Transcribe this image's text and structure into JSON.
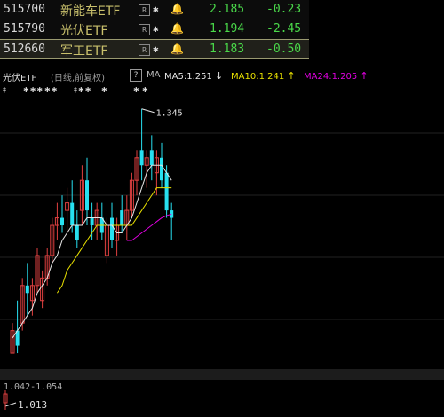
{
  "watchlist": [
    {
      "code": "515700",
      "name": "新能车ETF",
      "r_badge": "R",
      "star": "✱",
      "price": "2.185",
      "change": "-0.23"
    },
    {
      "code": "515790",
      "name": "光伏ETF",
      "r_badge": "R",
      "star": "✱",
      "price": "1.194",
      "change": "-2.45"
    },
    {
      "code": "512660",
      "name": "军工ETF",
      "r_badge": "R",
      "star": "✱",
      "price": "1.183",
      "change": "-0.50"
    }
  ],
  "chart_header": {
    "name": "光伏ETF",
    "mode": "(日线,前复权)",
    "help": "?",
    "ma_label": "MA",
    "ma5": "MA5:1.251",
    "ma5_arrow": "↓",
    "ma10": "MA10:1.241",
    "ma10_arrow": "↑",
    "ma24": "MA24:1.205",
    "ma24_arrow": "↑"
  },
  "markers": [
    {
      "text": "‡"
    },
    {
      "text": "✱✱✱"
    },
    {
      "text": "✱✱"
    },
    {
      "text": "‡✱✱"
    },
    {
      "text": "✱"
    },
    {
      "text": "✱"
    },
    {
      "text": "✱"
    }
  ],
  "colors": {
    "up": "#e04040",
    "down": "#27e0f0",
    "ma5": "#e6e6e6",
    "ma10": "#e8e000",
    "ma24": "#e000e0",
    "price_change": "#4ad94a",
    "name": "#c9c06c"
  },
  "range_text": "1.042-1.054",
  "high_label": "1.345",
  "low_label": "1.013",
  "chart_data": {
    "type": "candlestick",
    "x_unit": "trading day",
    "ylim": [
      1.0,
      1.36
    ],
    "high_annotation": 1.345,
    "low_annotation": 1.013,
    "candles": [
      {
        "o": 1.02,
        "h": 1.06,
        "l": 1.02,
        "c": 1.05
      },
      {
        "o": 1.05,
        "h": 1.09,
        "l": 1.02,
        "c": 1.03
      },
      {
        "o": 1.06,
        "h": 1.12,
        "l": 1.05,
        "c": 1.11
      },
      {
        "o": 1.11,
        "h": 1.14,
        "l": 1.07,
        "c": 1.1
      },
      {
        "o": 1.09,
        "h": 1.12,
        "l": 1.07,
        "c": 1.11
      },
      {
        "o": 1.11,
        "h": 1.16,
        "l": 1.1,
        "c": 1.15
      },
      {
        "o": 1.09,
        "h": 1.13,
        "l": 1.08,
        "c": 1.12
      },
      {
        "o": 1.12,
        "h": 1.16,
        "l": 1.11,
        "c": 1.15
      },
      {
        "o": 1.15,
        "h": 1.2,
        "l": 1.14,
        "c": 1.19
      },
      {
        "o": 1.19,
        "h": 1.22,
        "l": 1.17,
        "c": 1.2
      },
      {
        "o": 1.2,
        "h": 1.23,
        "l": 1.18,
        "c": 1.19
      },
      {
        "o": 1.21,
        "h": 1.24,
        "l": 1.18,
        "c": 1.22
      },
      {
        "o": 1.22,
        "h": 1.25,
        "l": 1.18,
        "c": 1.19
      },
      {
        "o": 1.19,
        "h": 1.21,
        "l": 1.16,
        "c": 1.17
      },
      {
        "o": 1.21,
        "h": 1.27,
        "l": 1.19,
        "c": 1.25
      },
      {
        "o": 1.25,
        "h": 1.28,
        "l": 1.19,
        "c": 1.21
      },
      {
        "o": 1.2,
        "h": 1.22,
        "l": 1.17,
        "c": 1.19
      },
      {
        "o": 1.19,
        "h": 1.22,
        "l": 1.17,
        "c": 1.21
      },
      {
        "o": 1.2,
        "h": 1.22,
        "l": 1.17,
        "c": 1.18
      },
      {
        "o": 1.15,
        "h": 1.2,
        "l": 1.14,
        "c": 1.19
      },
      {
        "o": 1.2,
        "h": 1.22,
        "l": 1.16,
        "c": 1.17
      },
      {
        "o": 1.17,
        "h": 1.2,
        "l": 1.15,
        "c": 1.19
      },
      {
        "o": 1.21,
        "h": 1.23,
        "l": 1.18,
        "c": 1.19
      },
      {
        "o": 1.19,
        "h": 1.23,
        "l": 1.17,
        "c": 1.21
      },
      {
        "o": 1.21,
        "h": 1.26,
        "l": 1.2,
        "c": 1.25
      },
      {
        "o": 1.25,
        "h": 1.29,
        "l": 1.23,
        "c": 1.28
      },
      {
        "o": 1.29,
        "h": 1.345,
        "l": 1.25,
        "c": 1.27
      },
      {
        "o": 1.27,
        "h": 1.29,
        "l": 1.24,
        "c": 1.28
      },
      {
        "o": 1.29,
        "h": 1.31,
        "l": 1.25,
        "c": 1.27
      },
      {
        "o": 1.26,
        "h": 1.29,
        "l": 1.23,
        "c": 1.28
      },
      {
        "o": 1.28,
        "h": 1.3,
        "l": 1.24,
        "c": 1.25
      },
      {
        "o": 1.26,
        "h": 1.27,
        "l": 1.2,
        "c": 1.21
      },
      {
        "o": 1.21,
        "h": 1.22,
        "l": 1.17,
        "c": 1.2
      }
    ],
    "ma5": [
      1.04,
      1.05,
      1.06,
      1.07,
      1.08,
      1.1,
      1.11,
      1.12,
      1.14,
      1.15,
      1.17,
      1.18,
      1.19,
      1.19,
      1.19,
      1.2,
      1.2,
      1.2,
      1.2,
      1.19,
      1.19,
      1.18,
      1.18,
      1.19,
      1.2,
      1.22,
      1.24,
      1.26,
      1.27,
      1.27,
      1.27,
      1.26,
      1.25
    ],
    "ma10": [
      null,
      null,
      null,
      null,
      null,
      null,
      null,
      null,
      null,
      1.1,
      1.11,
      1.13,
      1.14,
      1.15,
      1.16,
      1.17,
      1.18,
      1.19,
      1.19,
      1.19,
      1.19,
      1.19,
      1.19,
      1.19,
      1.19,
      1.2,
      1.21,
      1.22,
      1.23,
      1.24,
      1.24,
      1.24,
      1.24
    ],
    "ma24": [
      null,
      null,
      null,
      null,
      null,
      null,
      null,
      null,
      null,
      null,
      null,
      null,
      null,
      null,
      null,
      null,
      null,
      null,
      null,
      null,
      null,
      null,
      null,
      1.17,
      1.17,
      1.175,
      1.18,
      1.185,
      1.19,
      1.195,
      1.2,
      1.203,
      1.205
    ]
  }
}
